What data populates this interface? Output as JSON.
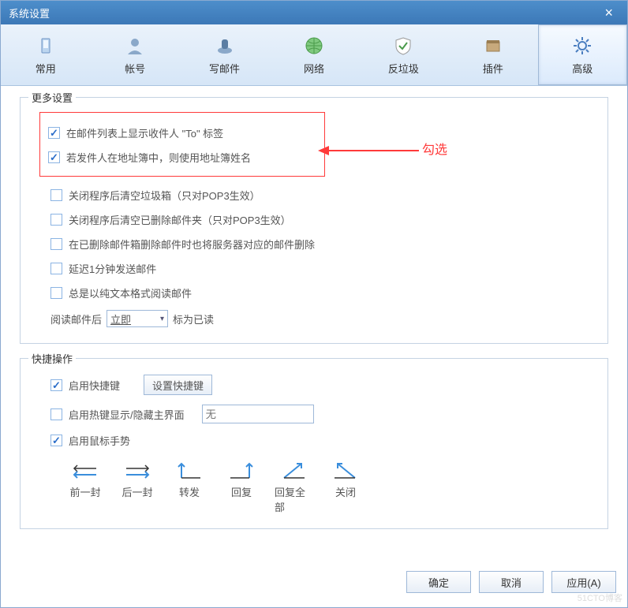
{
  "window": {
    "title": "系统设置"
  },
  "tabs": [
    {
      "id": "common",
      "label": "常用"
    },
    {
      "id": "account",
      "label": "帐号"
    },
    {
      "id": "compose",
      "label": "写邮件"
    },
    {
      "id": "network",
      "label": "网络"
    },
    {
      "id": "antispam",
      "label": "反垃圾"
    },
    {
      "id": "plugin",
      "label": "插件"
    },
    {
      "id": "advanced",
      "label": "高级",
      "active": true
    }
  ],
  "more_settings": {
    "legend": "更多设置",
    "opts": [
      {
        "label": "在邮件列表上显示收件人 \"To\" 标签",
        "checked": true,
        "highlighted": true
      },
      {
        "label": "若发件人在地址簿中，则使用地址簿姓名",
        "checked": true,
        "highlighted": true
      },
      {
        "label": "关闭程序后清空垃圾箱（只对POP3生效）",
        "checked": false
      },
      {
        "label": "关闭程序后清空已删除邮件夹（只对POP3生效）",
        "checked": false
      },
      {
        "label": "在已删除邮件箱删除邮件时也将服务器对应的邮件删除",
        "checked": false
      },
      {
        "label": "延迟1分钟发送邮件",
        "checked": false
      },
      {
        "label": "总是以纯文本格式阅读邮件",
        "checked": false
      }
    ],
    "read_prefix": "阅读邮件后",
    "read_combo": "立即",
    "read_suffix": "标为已读"
  },
  "quick": {
    "legend": "快捷操作",
    "enable_hotkey": {
      "label": "启用快捷键",
      "checked": true,
      "button": "设置快捷键"
    },
    "toggle_hotkey": {
      "label": "启用热键显示/隐藏主界面",
      "checked": false,
      "placeholder": "无"
    },
    "mouse_gesture": {
      "label": "启用鼠标手势",
      "checked": true
    },
    "gestures": [
      {
        "name": "prev",
        "label": "前一封"
      },
      {
        "name": "next",
        "label": "后一封"
      },
      {
        "name": "forward",
        "label": "转发"
      },
      {
        "name": "reply",
        "label": "回复"
      },
      {
        "name": "reply_all",
        "label": "回复全部"
      },
      {
        "name": "close",
        "label": "关闭"
      }
    ]
  },
  "annotation": {
    "text": "勾选"
  },
  "buttons": {
    "ok": "确定",
    "cancel": "取消",
    "apply": "应用(A)"
  },
  "watermark": "51CTO博客"
}
